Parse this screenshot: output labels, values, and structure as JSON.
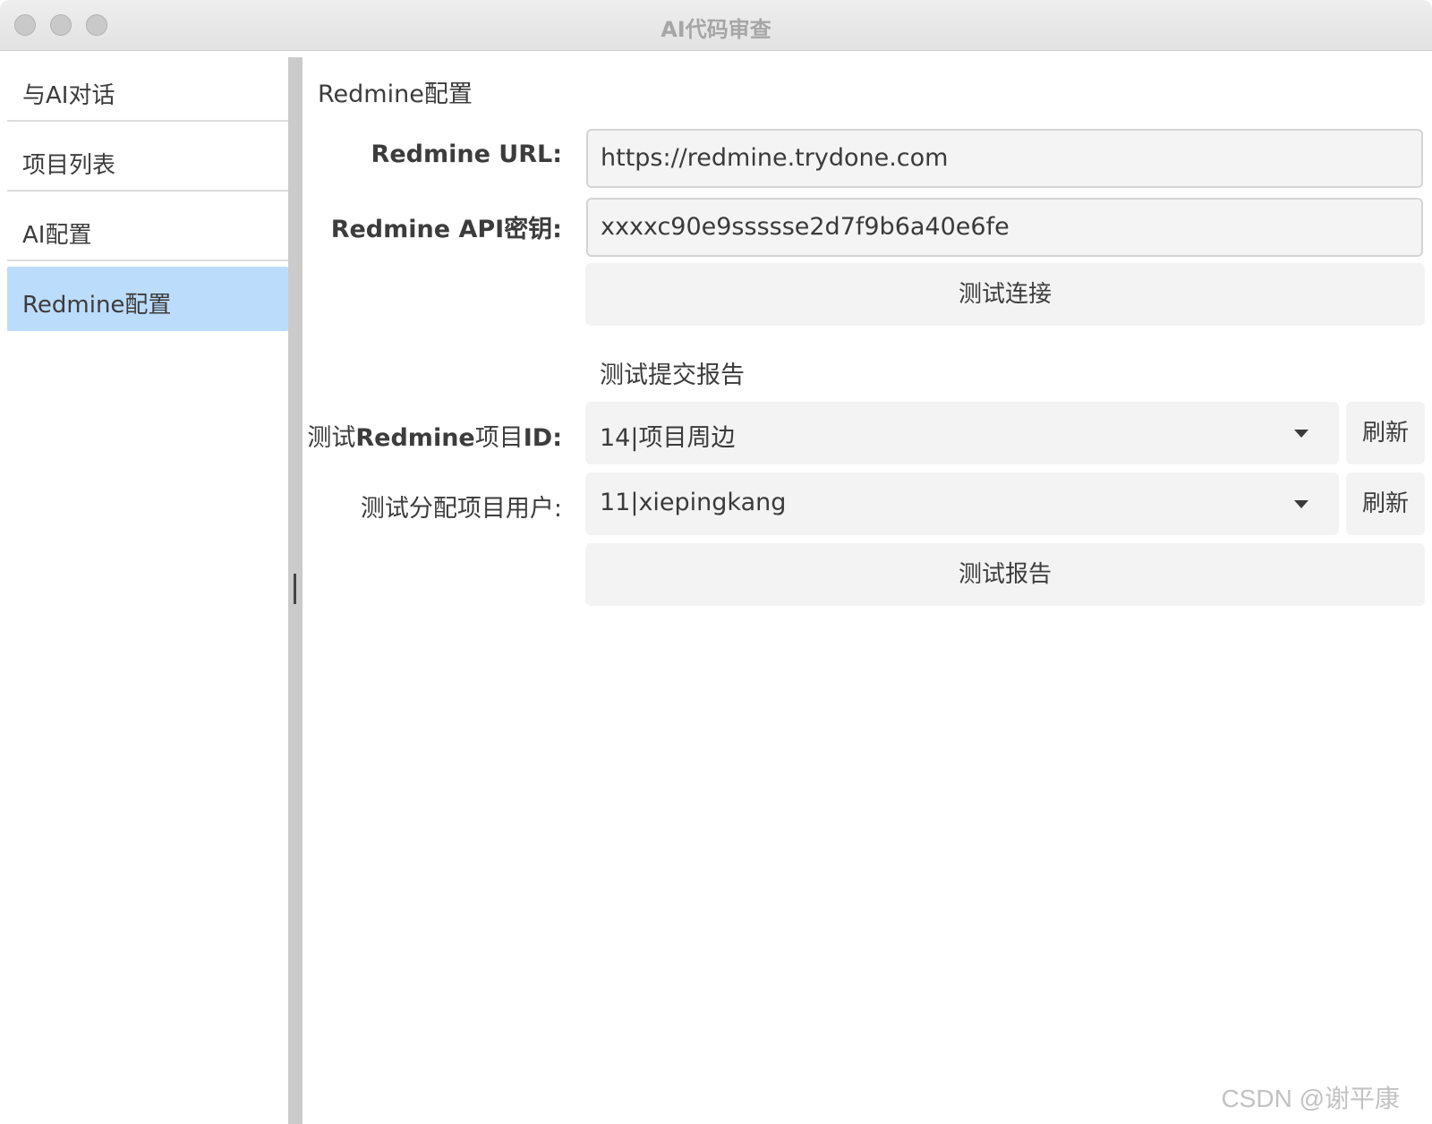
{
  "window": {
    "title": "AI代码审查"
  },
  "sidebar": {
    "items": [
      {
        "label": "与AI对话"
      },
      {
        "label": "项目列表"
      },
      {
        "label": "AI配置"
      },
      {
        "label": "Redmine配置",
        "active": true
      }
    ]
  },
  "main": {
    "section_title": "Redmine配置",
    "url_label": "Redmine URL:",
    "url_value": "https://redmine.trydone.com",
    "api_label_bold": "Redmine API",
    "api_label_rest": "密钥:",
    "api_value": "xxxxc90e9ssssse2d7f9b6a40e6fe",
    "test_connection_button": "测试连接",
    "report_heading": "测试提交报告",
    "project_label_prefix": "测试",
    "project_label_bold": "Redmine",
    "project_label_middle": "项目",
    "project_label_bold2": "ID:",
    "project_selected": "14|项目周边",
    "refresh_label": "刷新",
    "user_label": "测试分配项目用户:",
    "user_selected": "11|xiepingkang",
    "test_report_button": "测试报告"
  },
  "watermark": "CSDN @谢平康",
  "colors": {
    "active_nav_bg": "#bcdcfc",
    "splitter": "#cbcbcb"
  }
}
